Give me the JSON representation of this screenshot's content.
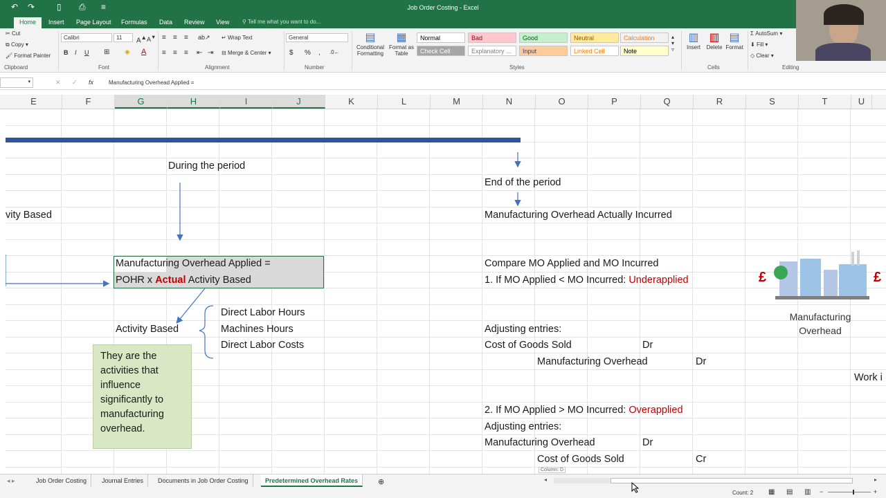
{
  "window": {
    "title": "Job Order Costing - Excel"
  },
  "ribbon_tabs": [
    "Home",
    "Insert",
    "Page Layout",
    "Formulas",
    "Data",
    "Review",
    "View"
  ],
  "tell_me": "Tell me what you want to do...",
  "clipboard": {
    "cut": "Cut",
    "copy": "Copy",
    "format_painter": "Format Painter",
    "label": "Clipboard"
  },
  "font": {
    "name": "Calibri",
    "size": "11",
    "bold": "B",
    "italic": "I",
    "underline": "U",
    "label": "Font"
  },
  "alignment": {
    "wrap_text": "Wrap Text",
    "merge_center": "Merge & Center",
    "label": "Alignment"
  },
  "number": {
    "format": "General",
    "currency": "$",
    "percent": "%",
    "comma": ",",
    "label": "Number"
  },
  "styles": {
    "conditional": [
      "Conditional",
      "Formatting"
    ],
    "format_as_table": [
      "Format as",
      "Table"
    ],
    "cells": [
      {
        "label": "Normal",
        "bg": "#ffffff",
        "color": "#000000"
      },
      {
        "label": "Bad",
        "bg": "#ffc7ce",
        "color": "#9c0006"
      },
      {
        "label": "Good",
        "bg": "#c6efce",
        "color": "#006100"
      },
      {
        "label": "Neutral",
        "bg": "#ffeb9c",
        "color": "#9c5700"
      },
      {
        "label": "Calculation",
        "bg": "#f2f2f2",
        "color": "#fa7d00"
      },
      {
        "label": "Check Cell",
        "bg": "#a5a5a5",
        "color": "#ffffff"
      },
      {
        "label": "Explanatory ...",
        "bg": "#ffffff",
        "color": "#7f7f7f"
      },
      {
        "label": "Input",
        "bg": "#ffcc99",
        "color": "#3f3f76"
      },
      {
        "label": "Linked Cell",
        "bg": "#ffffff",
        "color": "#fa7d00"
      },
      {
        "label": "Note",
        "bg": "#ffffcc",
        "color": "#000000"
      }
    ],
    "label": "Styles"
  },
  "cells_group": {
    "insert": "Insert",
    "delete": "Delete",
    "format": "Format",
    "label": "Cells"
  },
  "editing": {
    "autosum": "AutoSum",
    "fill": "Fill",
    "clear": "Clear",
    "label": "Editing"
  },
  "formula_bar": {
    "content": "Manufacturing Overhead Applied =",
    "fx": "fx"
  },
  "columns": [
    "E",
    "F",
    "G",
    "H",
    "I",
    "J",
    "K",
    "L",
    "M",
    "N",
    "O",
    "P",
    "Q",
    "R",
    "S",
    "T",
    "U"
  ],
  "sheet": {
    "during_period": "During the period",
    "activity_based_left": "vity Based",
    "mo_applied_line1": "Manufacturing Overhead Applied =",
    "mo_applied_line2_a": "POHR x ",
    "mo_applied_line2_b": "Actual",
    "mo_applied_line2_c": " Activity Based",
    "activity_based": "Activity Based",
    "activities": [
      "Direct Labor Hours",
      "Machines Hours",
      "Direct Labor Costs"
    ],
    "note_lines": [
      "They are the",
      "activities that",
      "influence",
      "significantly to",
      "manufacturing",
      "overhead."
    ],
    "end_period": "End of the period",
    "mo_actual": "Manufacturing Overhead Actually Incurred",
    "compare": "Compare MO Applied and MO Incurred",
    "case1_prefix": "1. If MO Applied < MO Incurred: ",
    "case1_result": "Underapplied",
    "adjusting1": "Adjusting entries:",
    "cogs1": "Cost of Goods Sold",
    "dr1": "Dr",
    "mo1": "Manufacturing Overhead",
    "dr2": "Dr",
    "work_in": "Work i",
    "case2_prefix": "2. If MO Applied > MO Incurred: ",
    "case2_result": "Overapplied",
    "adjusting2": "Adjusting entries:",
    "mo2": "Manufacturing Overhead",
    "dr3": "Dr",
    "cogs2": "Cost of Goods Sold",
    "cr1": "Cr",
    "factory_label": [
      "Manufacturing",
      "Overhead"
    ],
    "pound": "£",
    "column_tip": "Column: D"
  },
  "sheet_tabs": [
    "Job Order Costing",
    "Journal Entries",
    "Documents in Job Order Costing",
    "Predetermined Overhead Rates"
  ],
  "active_sheet": "Predetermined Overhead Rates",
  "status": {
    "count": "Count: 2"
  },
  "colors": {
    "excel_green": "#217346",
    "red_text": "#c00000",
    "arrow_blue": "#4472c4",
    "band_blue": "#2f5597",
    "note_bg": "#d9e7c4"
  }
}
